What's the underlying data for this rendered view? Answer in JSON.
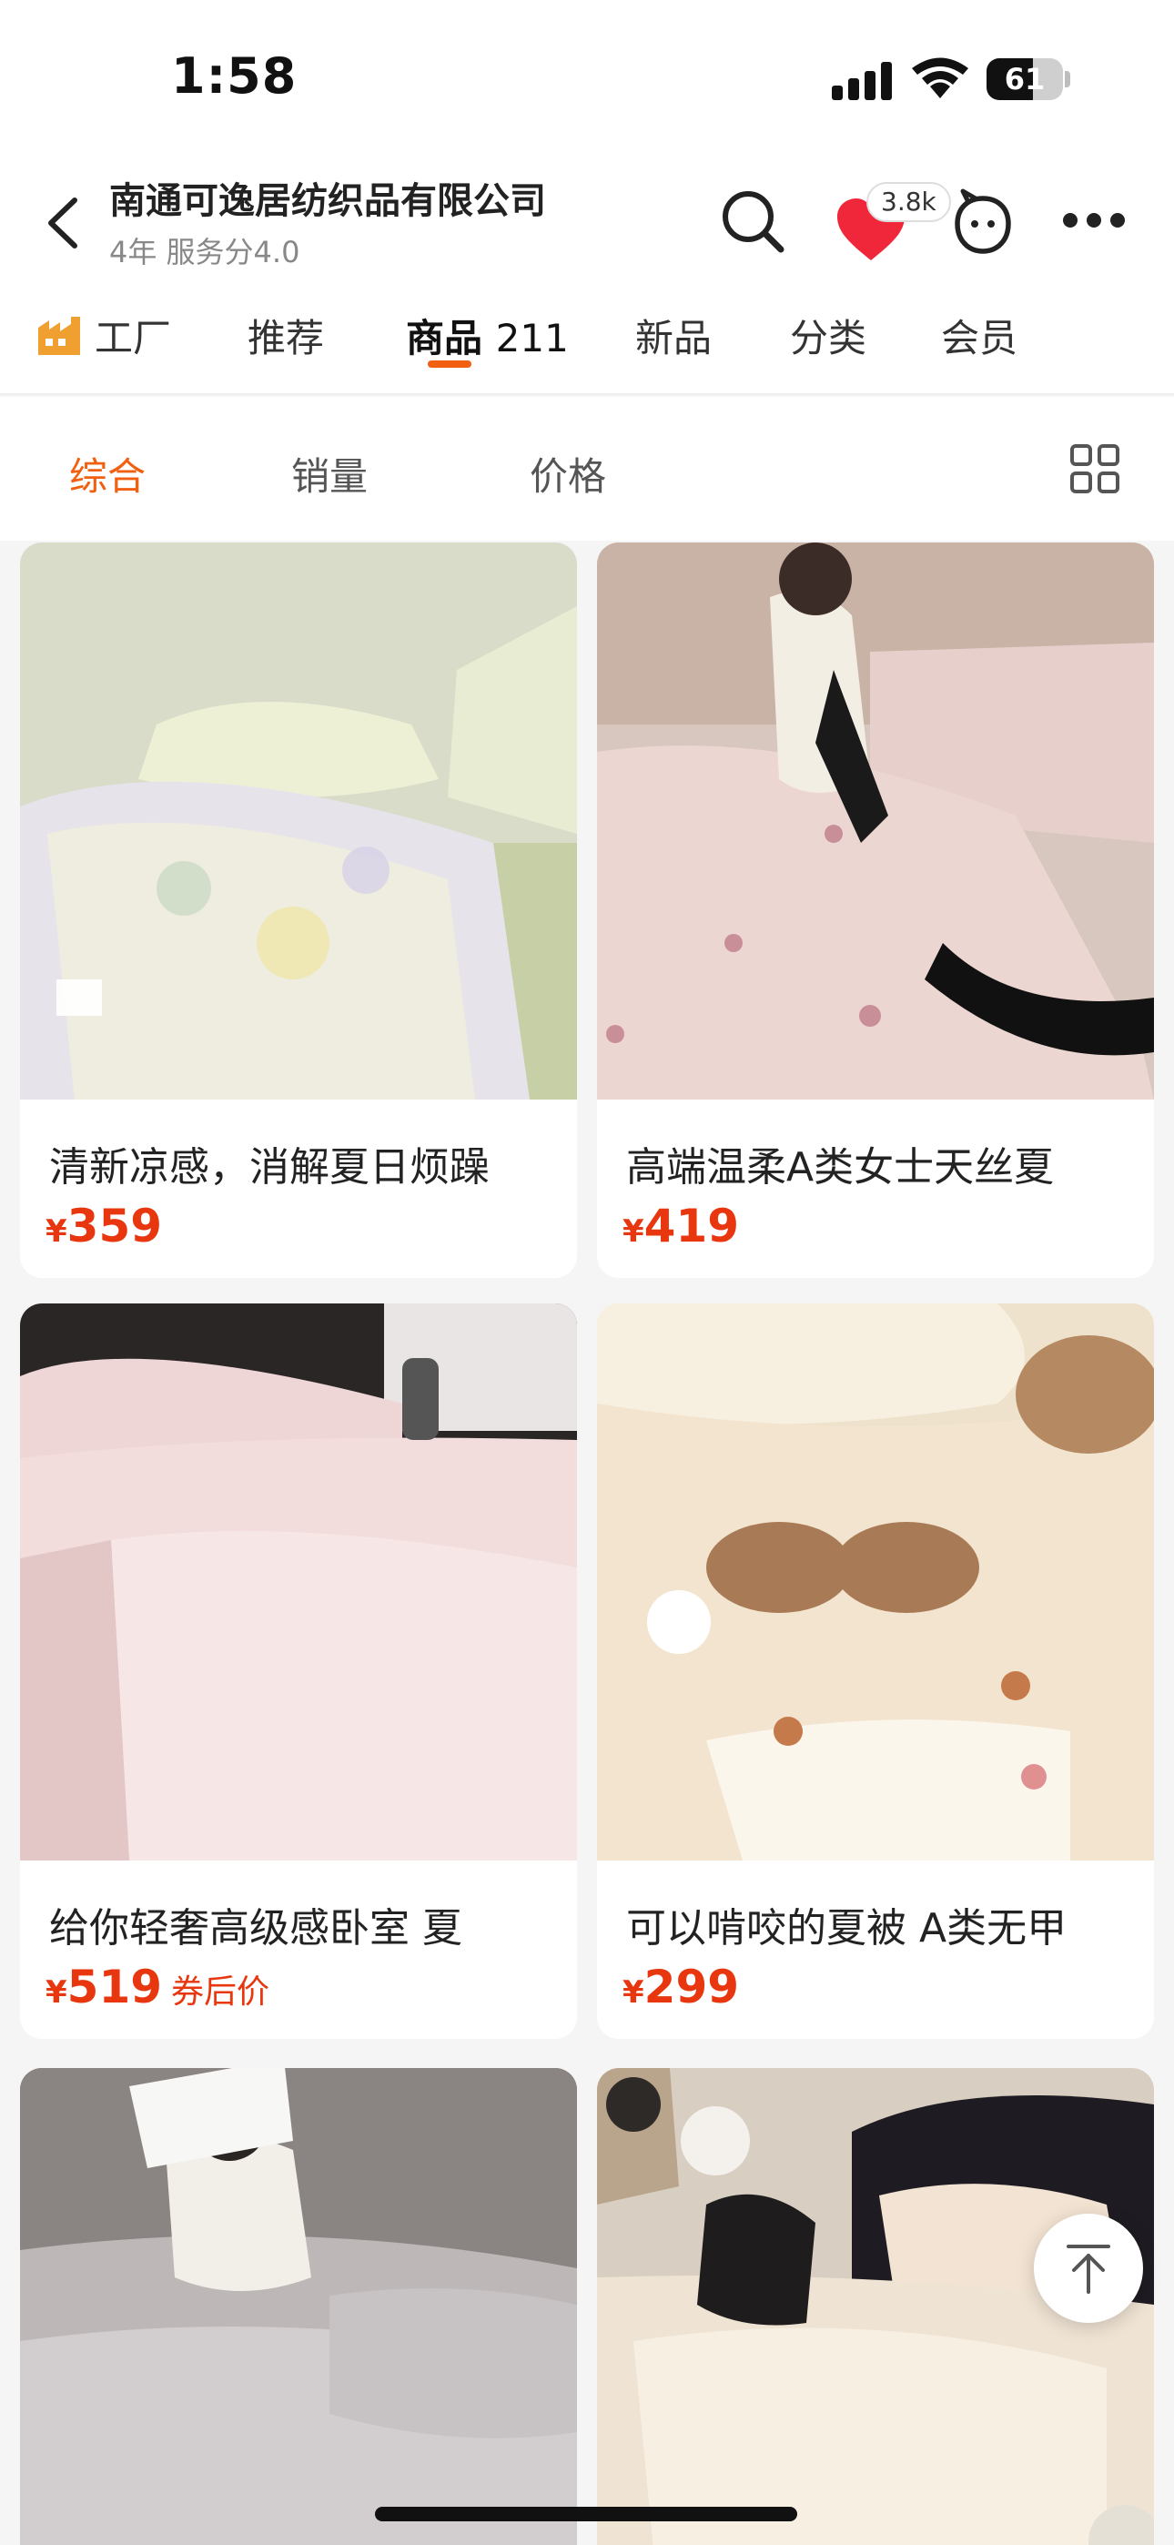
{
  "status_bar": {
    "time": "1:58",
    "battery": "61",
    "battery_level": 0.61
  },
  "header": {
    "shop_name": "南通可逸居纺织品有限公司",
    "shop_meta": "4年 服务分4.0",
    "favorite_count": "3.8k",
    "icons": [
      "back-icon",
      "search-icon",
      "heart-icon",
      "customer-service-icon",
      "more-icon"
    ]
  },
  "tabs": {
    "factory": "工厂",
    "recommend": "推荐",
    "products": "商品",
    "products_count": "211",
    "new": "新品",
    "category": "分类",
    "member": "会员"
  },
  "sort": {
    "overall": "综合",
    "sales": "销量",
    "price": "价格",
    "active": "综合"
  },
  "colors": {
    "accent": "#f06010",
    "price": "#e8360e"
  },
  "products": [
    {
      "title": "清新凉感，消解夏日烦躁",
      "price_symbol": "¥",
      "price": "359",
      "note": ""
    },
    {
      "title": "高端温柔A类女士天丝夏",
      "price_symbol": "¥",
      "price": "419",
      "note": ""
    },
    {
      "title": "给你轻奢高级感卧室 夏",
      "price_symbol": "¥",
      "price": "519",
      "note": "券后价"
    },
    {
      "title": "可以啃咬的夏被 A类无甲",
      "price_symbol": "¥",
      "price": "299",
      "note": ""
    },
    {
      "title": "",
      "price_symbol": "",
      "price": "",
      "note": ""
    },
    {
      "title": "",
      "price_symbol": "",
      "price": "",
      "note": ""
    }
  ]
}
